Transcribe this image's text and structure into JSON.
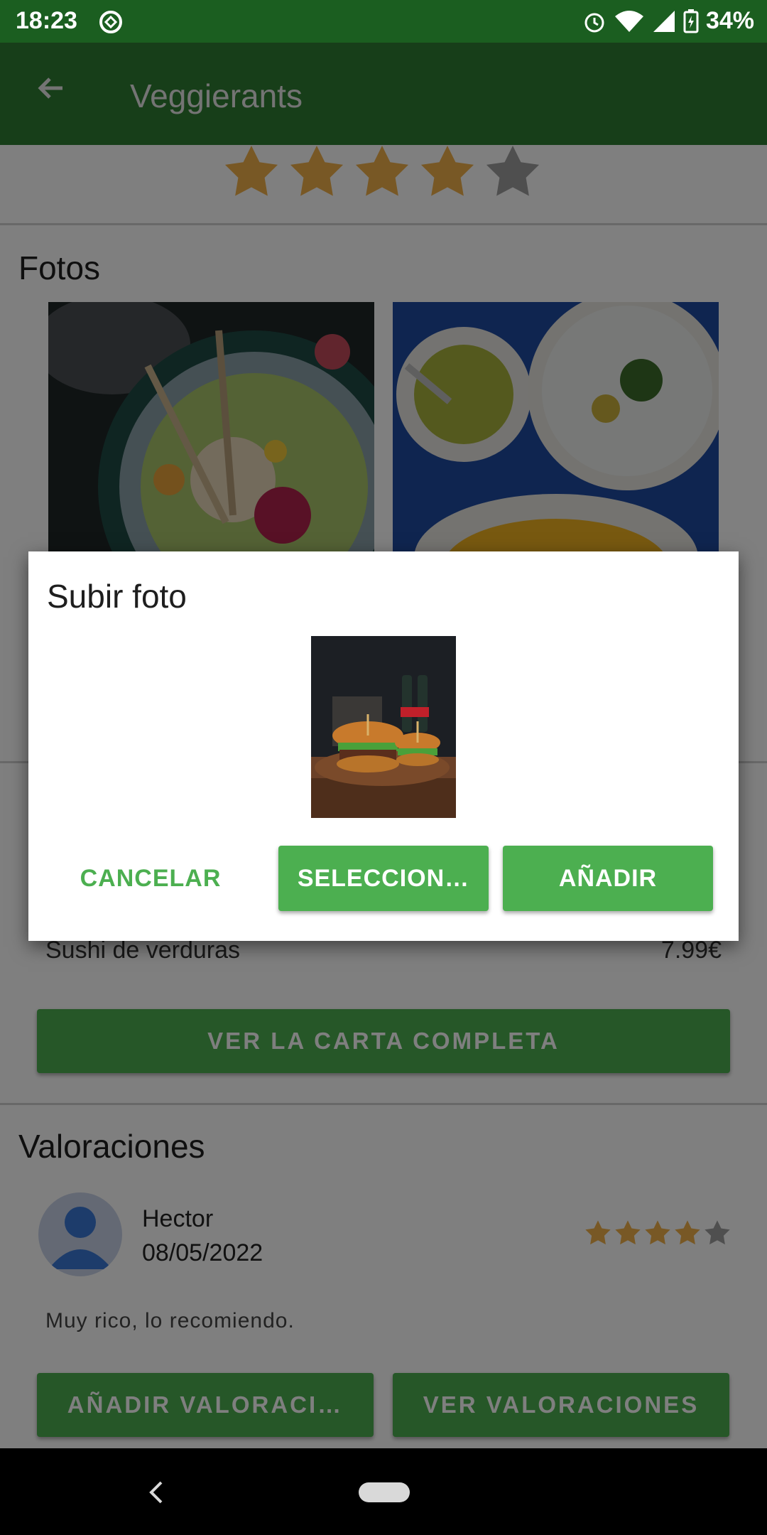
{
  "status_bar": {
    "time": "18:23",
    "battery": "34%"
  },
  "app_bar": {
    "title": "Veggierants"
  },
  "rating": {
    "stars": 4,
    "max": 5
  },
  "photos_section": {
    "title": "Fotos"
  },
  "menu": {
    "item_name": "Sushi de verduras",
    "item_price": "7.99€",
    "full_menu_button": "VER LA CARTA COMPLETA"
  },
  "reviews": {
    "title": "Valoraciones",
    "items": [
      {
        "author": "Hector",
        "date": "08/05/2022",
        "text": "Muy rico, lo recomiendo.",
        "stars": 4,
        "max": 5
      }
    ],
    "add_button": "AÑADIR VALORACI…",
    "view_button": "VER VALORACIONES"
  },
  "dialog": {
    "title": "Subir foto",
    "cancel": "CANCELAR",
    "select": "SELECCION…",
    "add": "AÑADIR"
  },
  "colors": {
    "primary": "#2e7d32",
    "accent": "#4caf50",
    "star_filled": "#f0b04a",
    "star_empty": "#9e9e9e"
  }
}
